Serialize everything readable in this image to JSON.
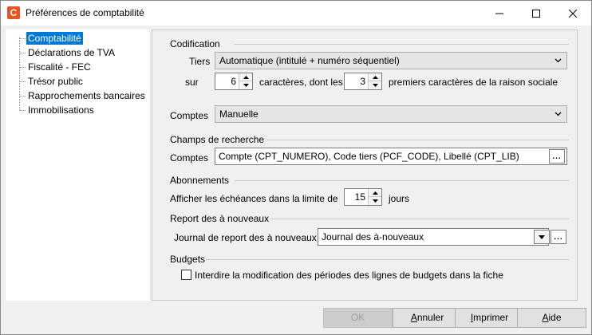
{
  "window": {
    "title": "Préférences de comptabilité",
    "app_icon_letter": "C"
  },
  "tree": {
    "items": [
      {
        "label": "Comptabilité",
        "selected": true
      },
      {
        "label": "Déclarations de TVA"
      },
      {
        "label": "Fiscalité - FEC"
      },
      {
        "label": "Trésor public"
      },
      {
        "label": "Rapprochements bancaires"
      },
      {
        "label": "Immobilisations"
      }
    ]
  },
  "codification": {
    "title": "Codification",
    "tiers_label": "Tiers",
    "tiers_value": "Automatique (intitulé + numéro séquentiel)",
    "sur_label": "sur",
    "sur_value": "6",
    "caracteres_label": "caractères, dont les",
    "premiers_value": "3",
    "premiers_label": "premiers caractères de la raison sociale",
    "comptes_label": "Comptes",
    "comptes_value": "Manuelle"
  },
  "champs": {
    "title": "Champs de recherche",
    "comptes_label": "Comptes",
    "comptes_value": "Compte (CPT_NUMERO), Code tiers (PCF_CODE), Libellé (CPT_LIB)",
    "browse_label": "..."
  },
  "abonnements": {
    "title": "Abonnements",
    "label": "Afficher les échéances dans la limite de",
    "value": "15",
    "unit": "jours"
  },
  "report": {
    "title": "Report des à nouveaux",
    "label": "Journal de report des à nouveaux",
    "value": "Journal des à-nouveaux",
    "browse_label": "..."
  },
  "budgets": {
    "title": "Budgets",
    "checkbox_label": "Interdire la modification des périodes des lignes de budgets dans la fiche",
    "checked": false
  },
  "buttons": {
    "ok": "OK",
    "annuler_u": "A",
    "annuler_rest": "nnuler",
    "imprimer_u": "I",
    "imprimer_rest": "mprimer",
    "aide_u": "A",
    "aide_rest": "ide"
  }
}
